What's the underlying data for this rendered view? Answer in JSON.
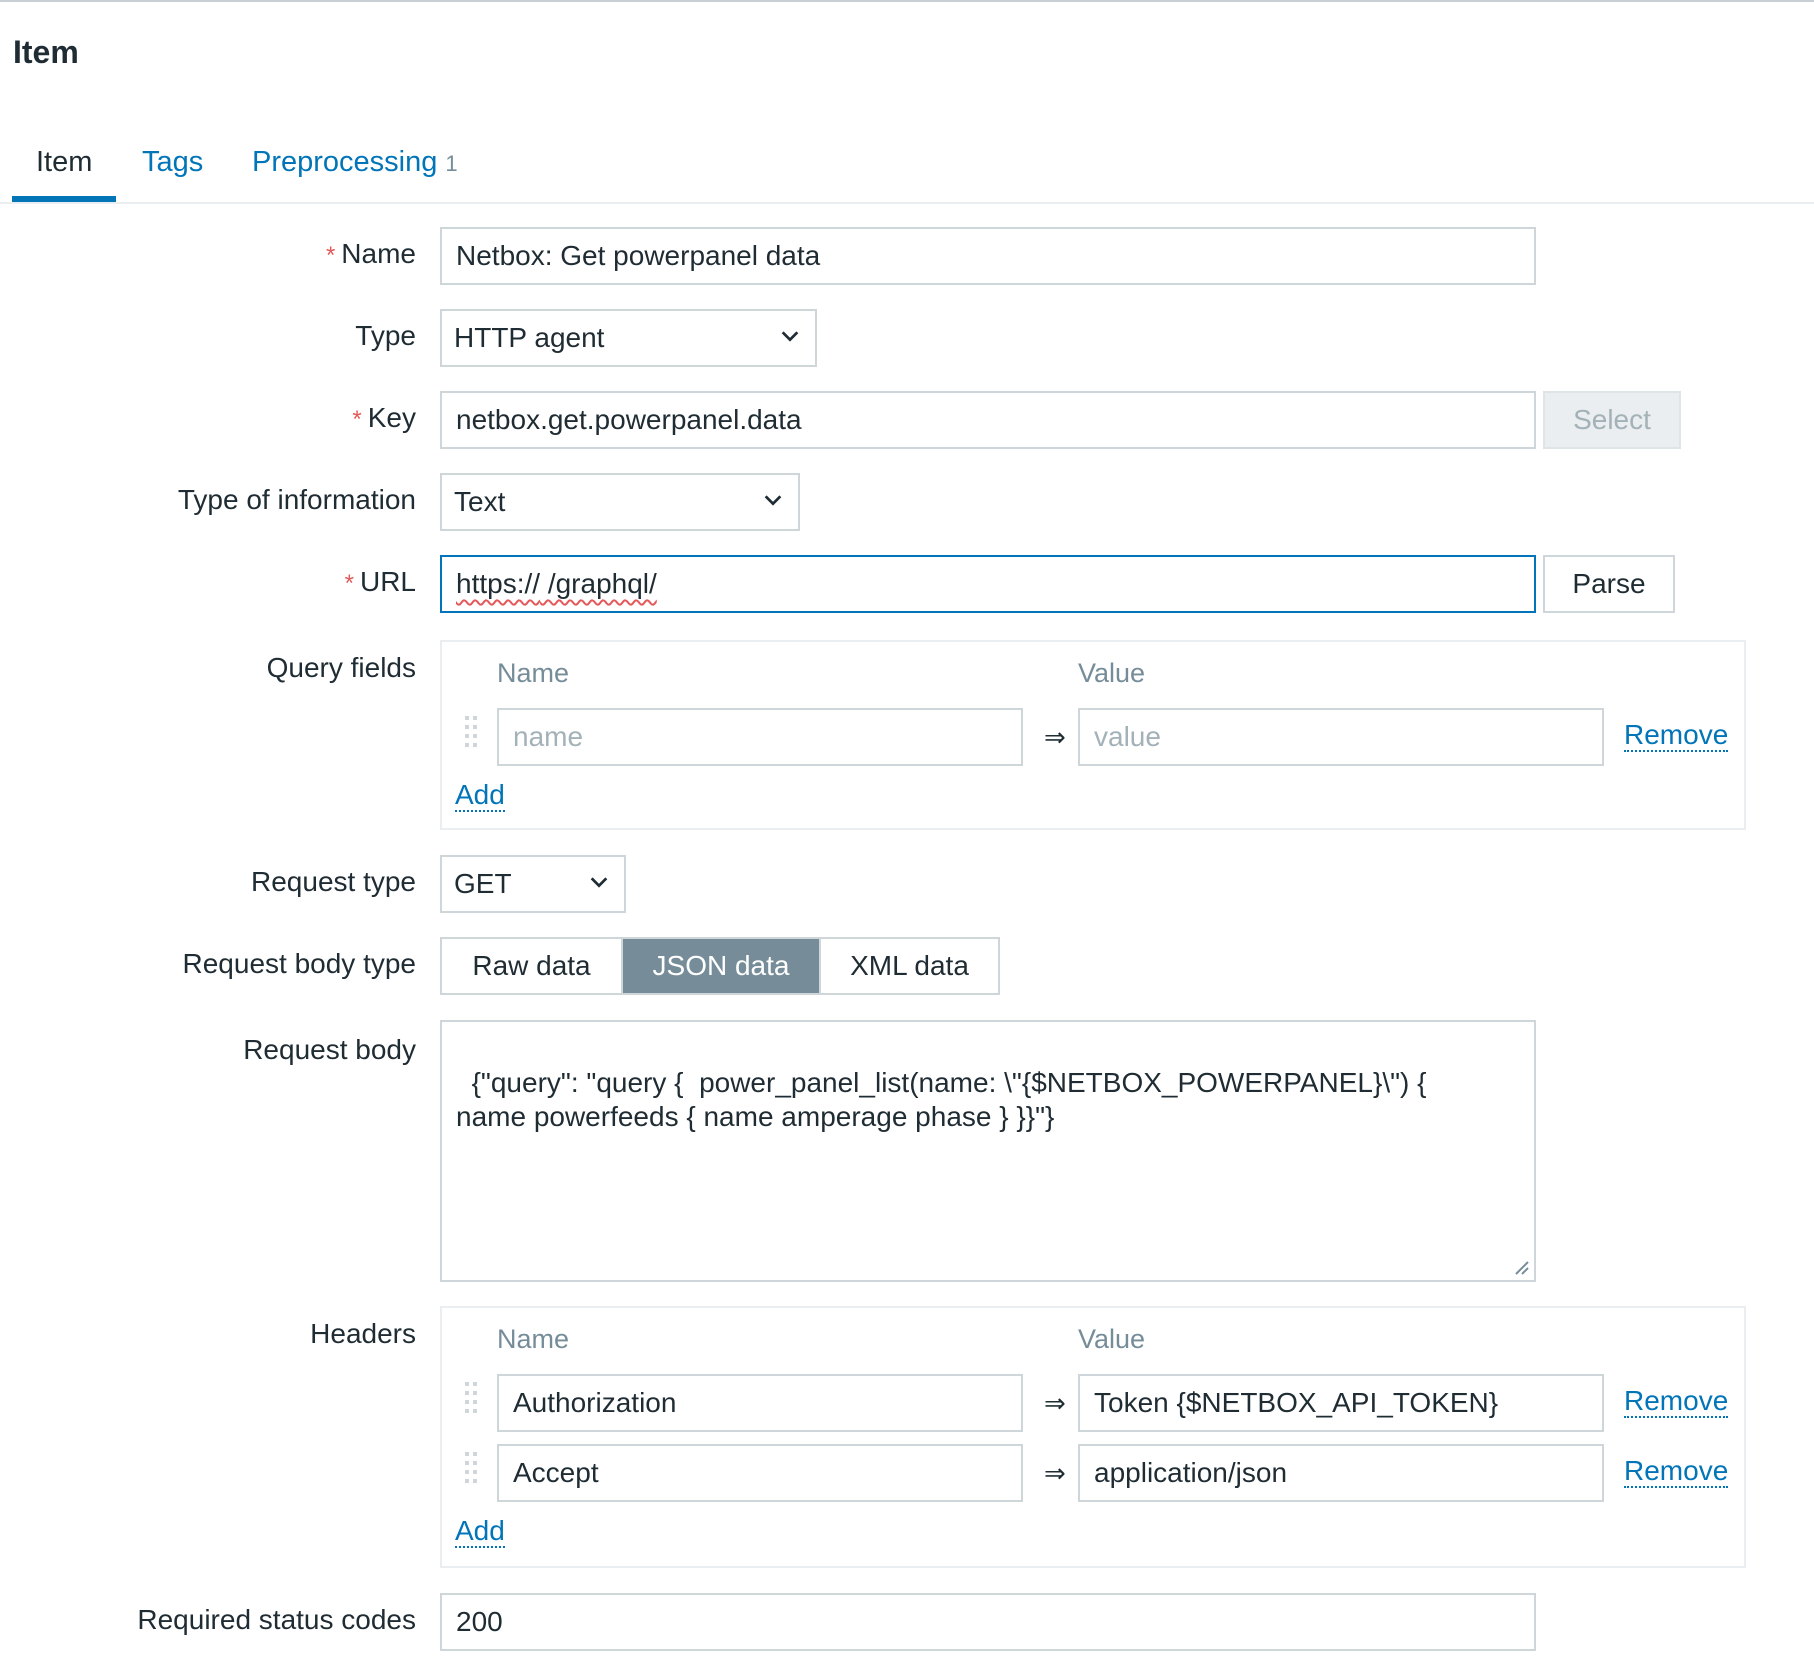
{
  "page": {
    "title": "Item"
  },
  "tabs": [
    {
      "label": "Item"
    },
    {
      "label": "Tags"
    },
    {
      "label": "Preprocessing",
      "count": "1"
    }
  ],
  "form": {
    "required_mark": "*",
    "name": {
      "label": "Name",
      "value": "Netbox: Get powerpanel data"
    },
    "type": {
      "label": "Type",
      "value": "HTTP agent"
    },
    "key": {
      "label": "Key",
      "value": "netbox.get.powerpanel.data",
      "select_label": "Select"
    },
    "type_of_information": {
      "label": "Type of information",
      "value": "Text"
    },
    "url": {
      "label": "URL",
      "value_scheme": "https://",
      "value_path": " /graphql/",
      "parse_label": "Parse"
    },
    "query_fields": {
      "label": "Query fields",
      "col_name": "Name",
      "col_value": "Value",
      "name_placeholder": "name",
      "value_placeholder": "value",
      "arrow": "⇒",
      "remove_label": "Remove",
      "add_label": "Add"
    },
    "request_type": {
      "label": "Request type",
      "value": "GET"
    },
    "request_body_type": {
      "label": "Request body type",
      "options": [
        "Raw data",
        "JSON data",
        "XML data"
      ],
      "selected": "JSON data"
    },
    "request_body": {
      "label": "Request body",
      "value": "{\"query\": \"query {  power_panel_list(name: \\\"{$NETBOX_POWERPANEL}\\\") {\nname powerfeeds { name amperage phase } }}\"}"
    },
    "headers": {
      "label": "Headers",
      "col_name": "Name",
      "col_value": "Value",
      "arrow": "⇒",
      "remove_label": "Remove",
      "add_label": "Add",
      "rows": [
        {
          "name": "Authorization",
          "value": "Token {$NETBOX_API_TOKEN}"
        },
        {
          "name": "Accept",
          "value": "application/json"
        }
      ]
    },
    "required_status_codes": {
      "label": "Required status codes",
      "value": "200"
    }
  },
  "colors": {
    "link": "#0275b8",
    "required": "#e45959",
    "segment_selected": "#768d99"
  },
  "icons": {
    "select_chevron": "chevron-down-icon",
    "drag": "drag-handle-icon",
    "resize": "resize-handle-icon"
  }
}
